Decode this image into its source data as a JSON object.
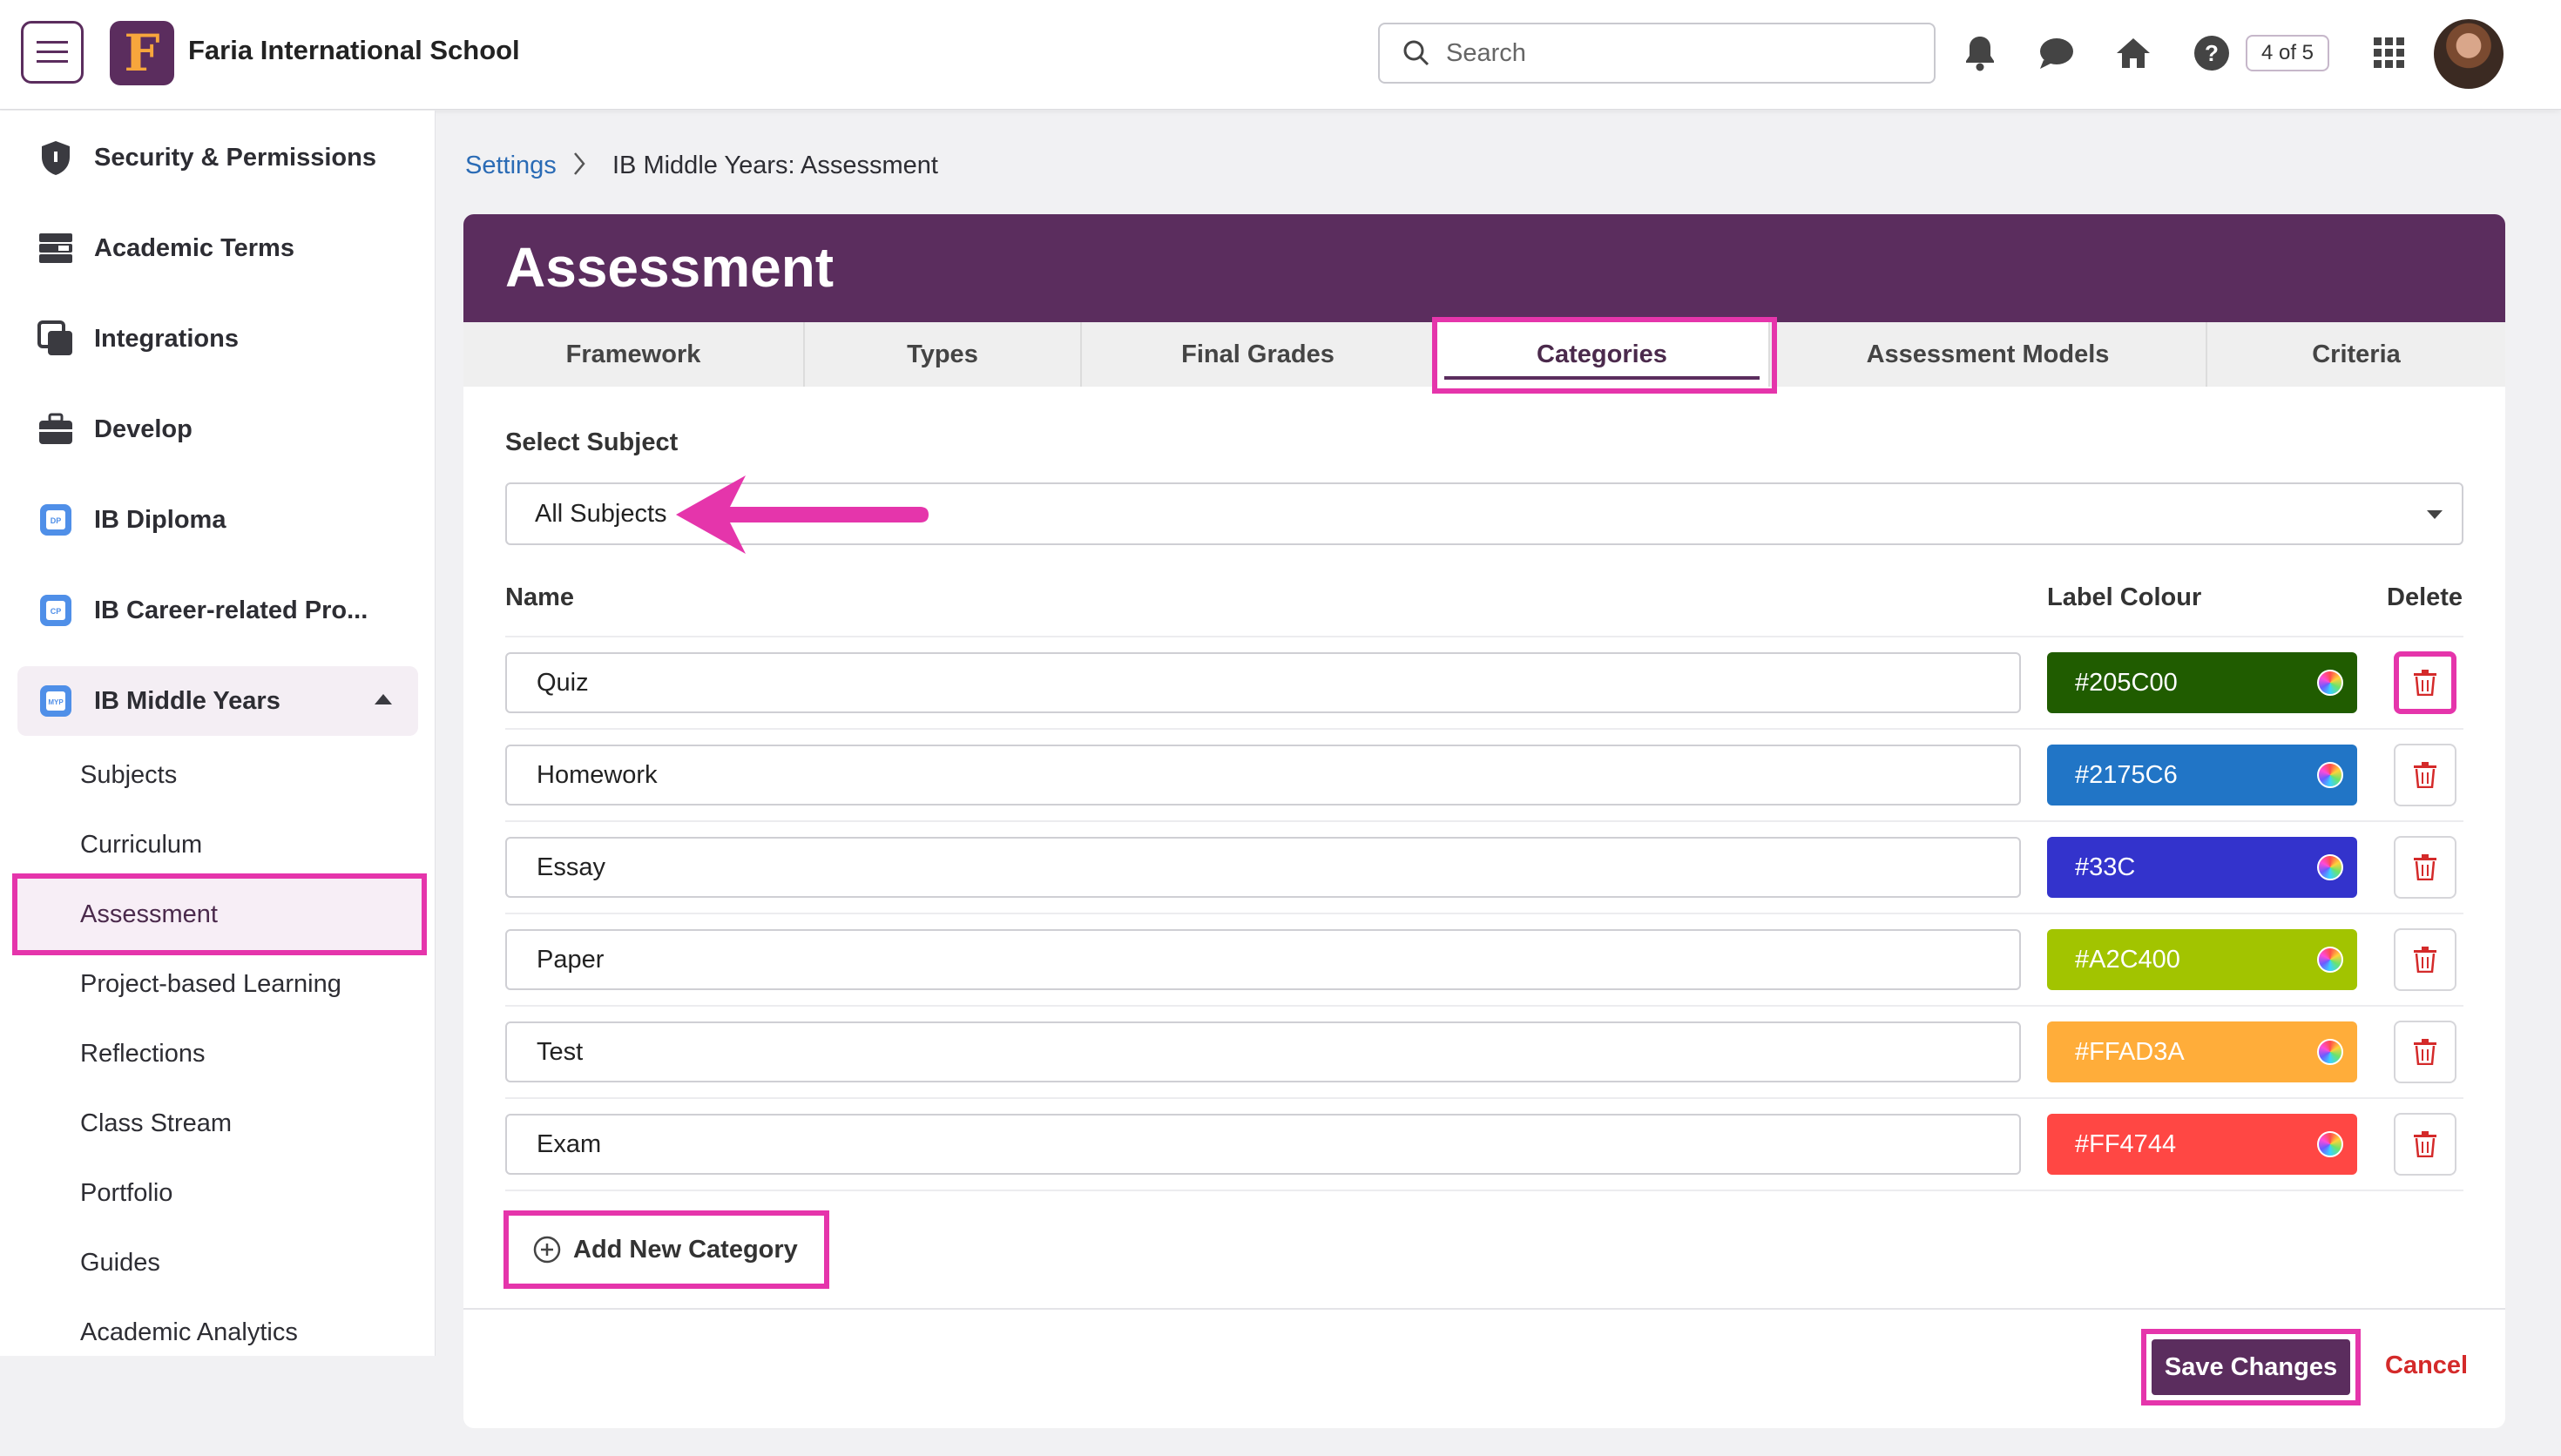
{
  "header": {
    "school_name": "Faria International School",
    "logo_letter": "F",
    "search_placeholder": "Search",
    "page_counter": "4 of 5"
  },
  "sidebar": {
    "items": [
      {
        "label": "Security & Permissions",
        "icon": "shield-icon"
      },
      {
        "label": "Academic Terms",
        "icon": "calendar-stack-icon"
      },
      {
        "label": "Integrations",
        "icon": "integrations-icon"
      },
      {
        "label": "Develop",
        "icon": "briefcase-icon"
      },
      {
        "label": "IB Diploma",
        "icon": "dp-programme-icon"
      },
      {
        "label": "IB Career-related Pro...",
        "icon": "cp-programme-icon"
      },
      {
        "label": "IB Middle Years",
        "icon": "myp-programme-icon"
      }
    ],
    "sub_items": [
      "Subjects",
      "Curriculum",
      "Assessment",
      "Project-based Learning",
      "Reflections",
      "Class Stream",
      "Portfolio",
      "Guides",
      "Academic Analytics"
    ]
  },
  "breadcrumb": {
    "link": "Settings",
    "current": "IB Middle Years: Assessment"
  },
  "card": {
    "title": "Assessment",
    "tabs": [
      "Framework",
      "Types",
      "Final Grades",
      "Categories",
      "Assessment Models",
      "Criteria"
    ],
    "active_tab": "Categories"
  },
  "form": {
    "select_label": "Select Subject",
    "select_value": "All Subjects",
    "col_name": "Name",
    "col_colour": "Label Colour",
    "col_delete": "Delete",
    "categories": [
      {
        "name": "Quiz",
        "colour": "#205C00"
      },
      {
        "name": "Homework",
        "colour": "#2175C6"
      },
      {
        "name": "Essay",
        "colour": "#33C"
      },
      {
        "name": "Paper",
        "colour": "#A2C400"
      },
      {
        "name": "Test",
        "colour": "#FFAD3A"
      },
      {
        "name": "Exam",
        "colour": "#FF4744"
      }
    ],
    "add_label": "Add New Category"
  },
  "footer": {
    "save_label": "Save Changes",
    "cancel_label": "Cancel"
  },
  "colors": {
    "brand": "#5b2d5e",
    "highlight": "#e535ab",
    "link": "#2a6bb5",
    "danger": "#d42a2a"
  }
}
